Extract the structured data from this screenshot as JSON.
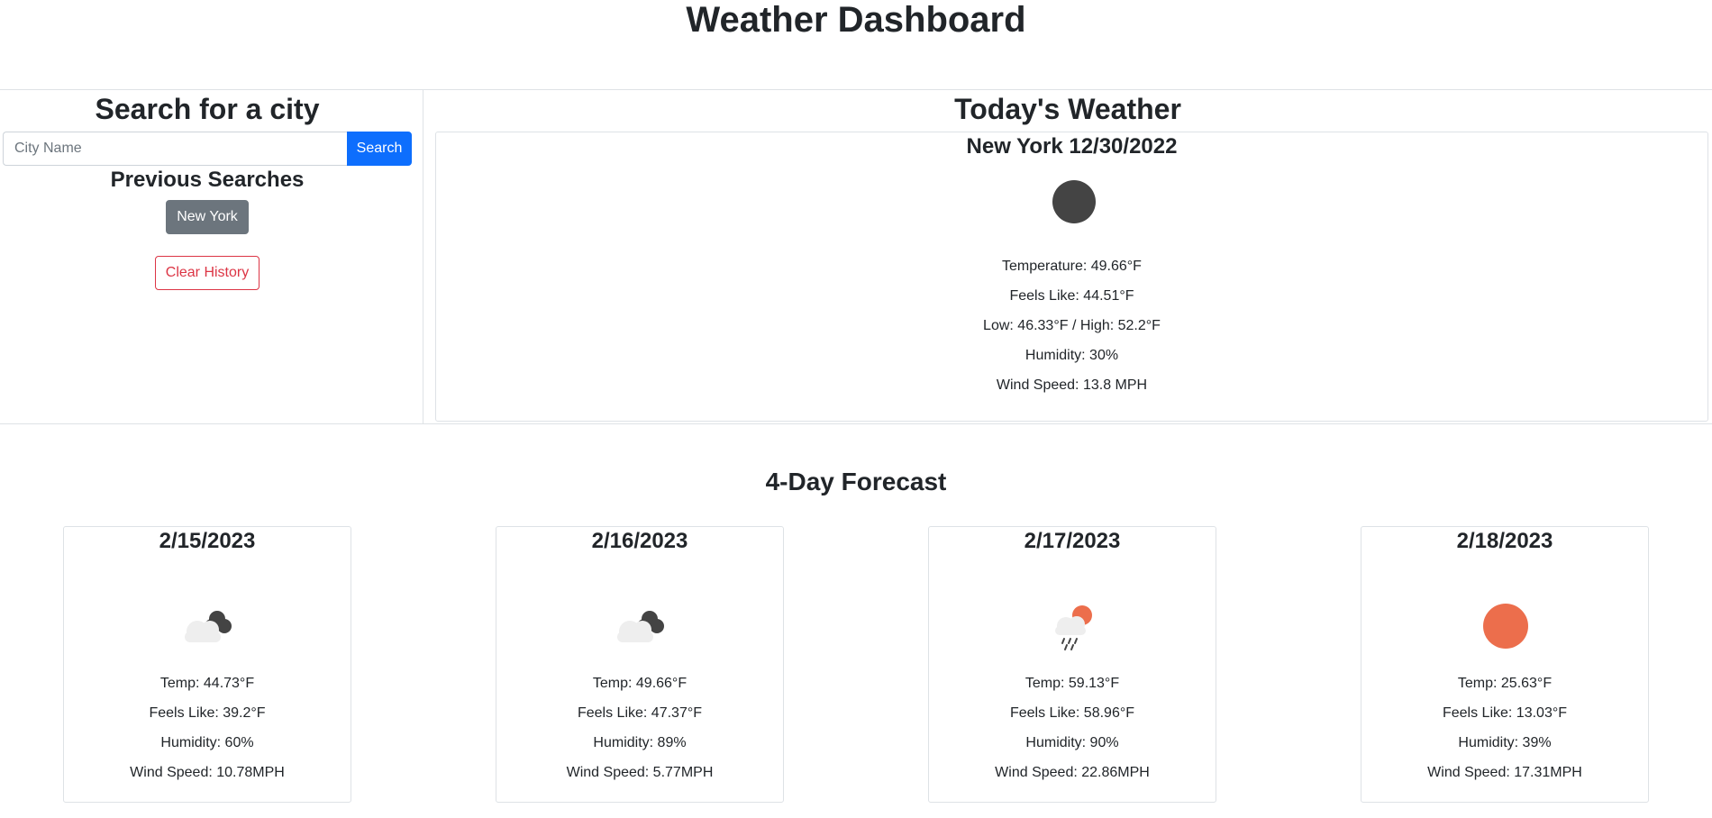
{
  "header": {
    "title": "Weather Dashboard"
  },
  "search": {
    "title": "Search for a city",
    "placeholder": "City Name",
    "button_label": "Search",
    "previous_title": "Previous Searches",
    "history": [
      {
        "label": "New York"
      }
    ],
    "clear_label": "Clear History"
  },
  "today": {
    "title": "Today's Weather",
    "city_date": "New York 12/30/2022",
    "icon": "dark-circle-icon",
    "temperature": "Temperature: 49.66°F",
    "feels_like": "Feels Like: 44.51°F",
    "low_high": "Low: 46.33°F / High: 52.2°F",
    "humidity": "Humidity: 30%",
    "wind": "Wind Speed: 13.8 MPH"
  },
  "forecast": {
    "title": "4-Day Forecast",
    "days": [
      {
        "date": "2/15/2023",
        "icon": "broken-clouds-icon",
        "temp": "Temp: 44.73°F",
        "feels_like": "Feels Like: 39.2°F",
        "humidity": "Humidity: 60%",
        "wind": "Wind Speed: 10.78MPH"
      },
      {
        "date": "2/16/2023",
        "icon": "broken-clouds-icon",
        "temp": "Temp: 49.66°F",
        "feels_like": "Feels Like: 47.37°F",
        "humidity": "Humidity: 89%",
        "wind": "Wind Speed: 5.77MPH"
      },
      {
        "date": "2/17/2023",
        "icon": "sun-rain-icon",
        "temp": "Temp: 59.13°F",
        "feels_like": "Feels Like: 58.96°F",
        "humidity": "Humidity: 90%",
        "wind": "Wind Speed: 22.86MPH"
      },
      {
        "date": "2/18/2023",
        "icon": "sun-icon",
        "temp": "Temp: 25.63°F",
        "feels_like": "Feels Like: 13.03°F",
        "humidity": "Humidity: 39%",
        "wind": "Wind Speed: 17.31MPH"
      }
    ]
  },
  "colors": {
    "primary": "#0d6efd",
    "secondary": "#6c757d",
    "danger": "#dc3545",
    "sun": "#ec6e4c",
    "cloud_dark": "#444444",
    "cloud_light": "#eeeeee"
  }
}
